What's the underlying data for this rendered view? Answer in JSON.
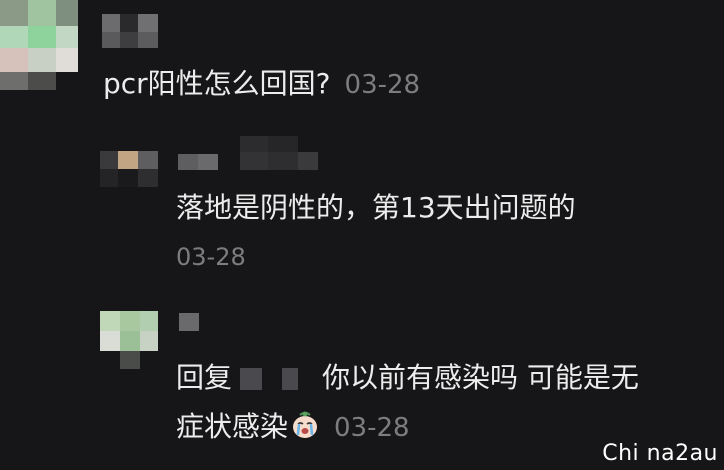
{
  "comments": [
    {
      "text": "pcr阳性怎么回国?",
      "date": "03-28"
    }
  ],
  "replies": [
    {
      "text": "落地是阴性的，第13天出问题的",
      "date": "03-28"
    },
    {
      "reply_prefix": "回复",
      "line1_text": "你以前有感染吗 可能是无",
      "line2_text": "症状感染",
      "emoji": "crying-face-emoji",
      "date": "03-28"
    }
  ],
  "watermark": "Chi na2au"
}
